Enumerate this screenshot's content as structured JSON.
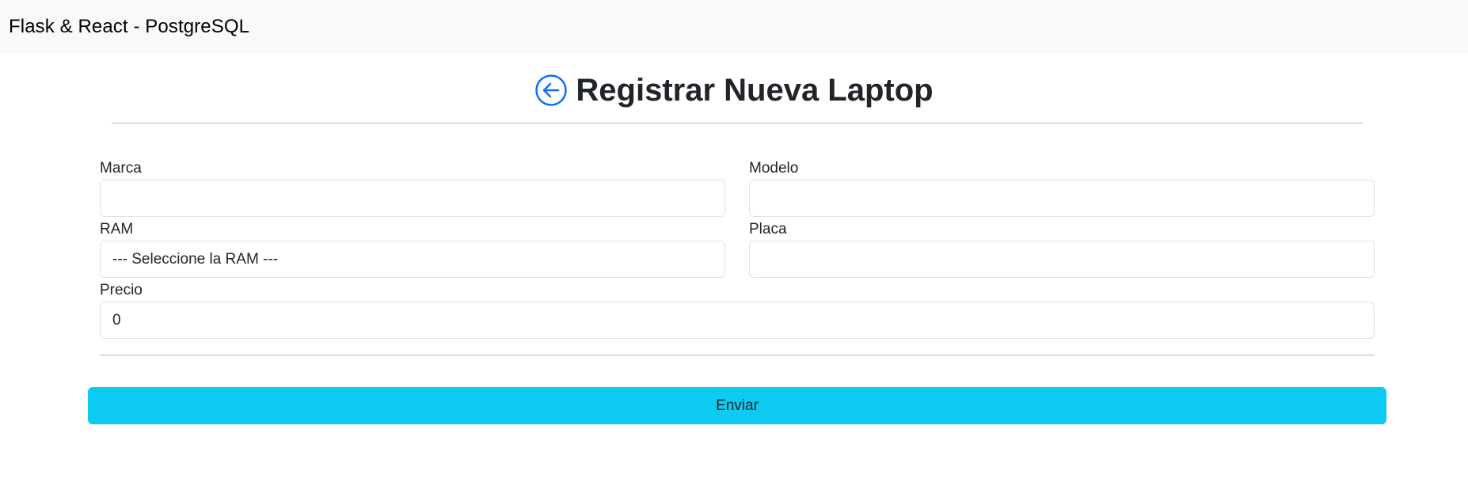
{
  "navbar": {
    "brand": "Flask & React - PostgreSQL"
  },
  "header": {
    "back_icon": "arrow-left-circle-icon",
    "title": "Registrar Nueva Laptop",
    "accent_color": "#0d6efd"
  },
  "form": {
    "marca": {
      "label": "Marca",
      "value": ""
    },
    "modelo": {
      "label": "Modelo",
      "value": ""
    },
    "ram": {
      "label": "RAM",
      "selected": "--- Seleccione la RAM ---"
    },
    "placa": {
      "label": "Placa",
      "value": ""
    },
    "precio": {
      "label": "Precio",
      "value": "0"
    },
    "submit_label": "Enviar",
    "submit_color": "#0dcaf0"
  }
}
